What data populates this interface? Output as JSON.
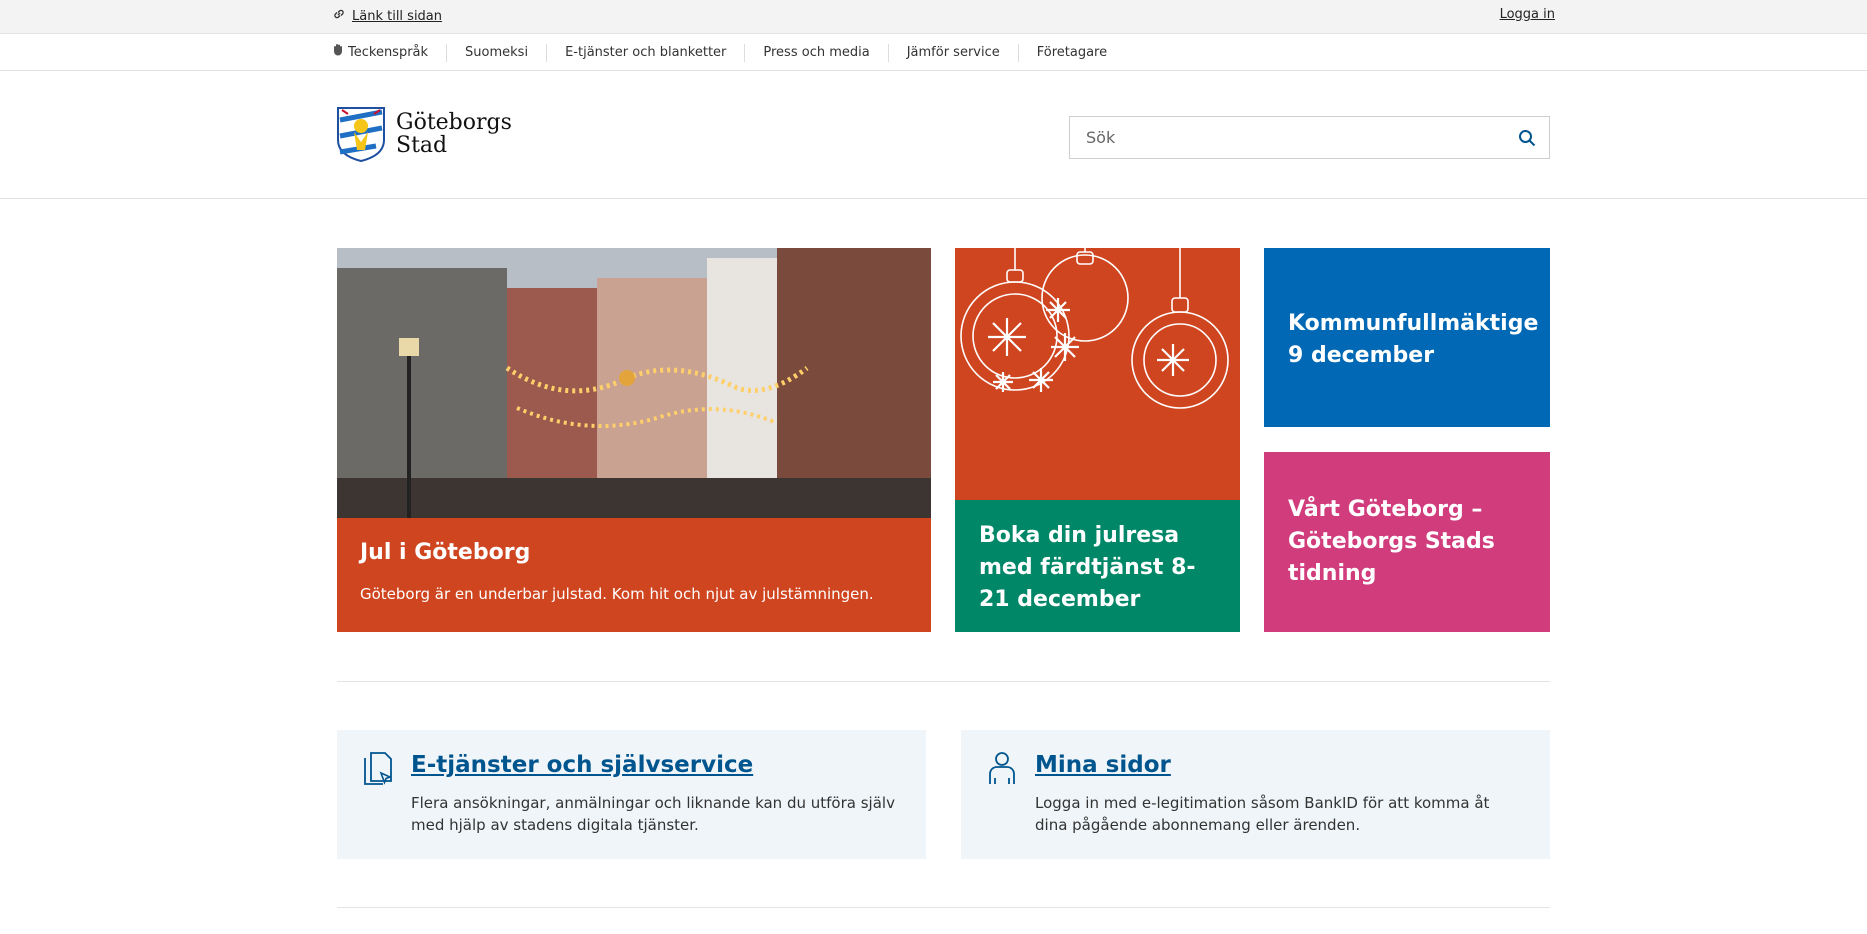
{
  "topbar": {
    "link_label": "Länk till sidan",
    "login_label": "Logga in"
  },
  "nav": [
    "Teckenspråk",
    "Suomeksi",
    "E-tjänster och blanketter",
    "Press och media",
    "Jämför service",
    "Företagare"
  ],
  "logo": {
    "line1": "Göteborgs",
    "line2": "Stad"
  },
  "search": {
    "placeholder": "Sök"
  },
  "tiles": {
    "jul": {
      "title": "Jul i Göteborg",
      "text": "Göteborg är en underbar julstad. Kom hit och njut av julstämningen."
    },
    "resa": {
      "title": "Boka din julresa med färdtjänst 8-21 december"
    },
    "kf": {
      "title": "Kommunfullmäktige 9 december"
    },
    "vg": {
      "title": "Vårt Göteborg – Göteborgs Stads tidning"
    }
  },
  "services": [
    {
      "title": "E-tjänster och självservice",
      "text": "Flera ansökningar, anmälningar och liknande kan du utföra själv med hjälp av stadens digitala tjänster."
    },
    {
      "title": "Mina sidor",
      "text": "Logga in med e-legitimation såsom BankID för att komma åt dina pågående abonnemang eller ärenden."
    }
  ],
  "colors": {
    "orange": "#cf4520",
    "green": "#008767",
    "blue": "#0068b4",
    "pink": "#d13c7d",
    "link": "#00558f"
  }
}
